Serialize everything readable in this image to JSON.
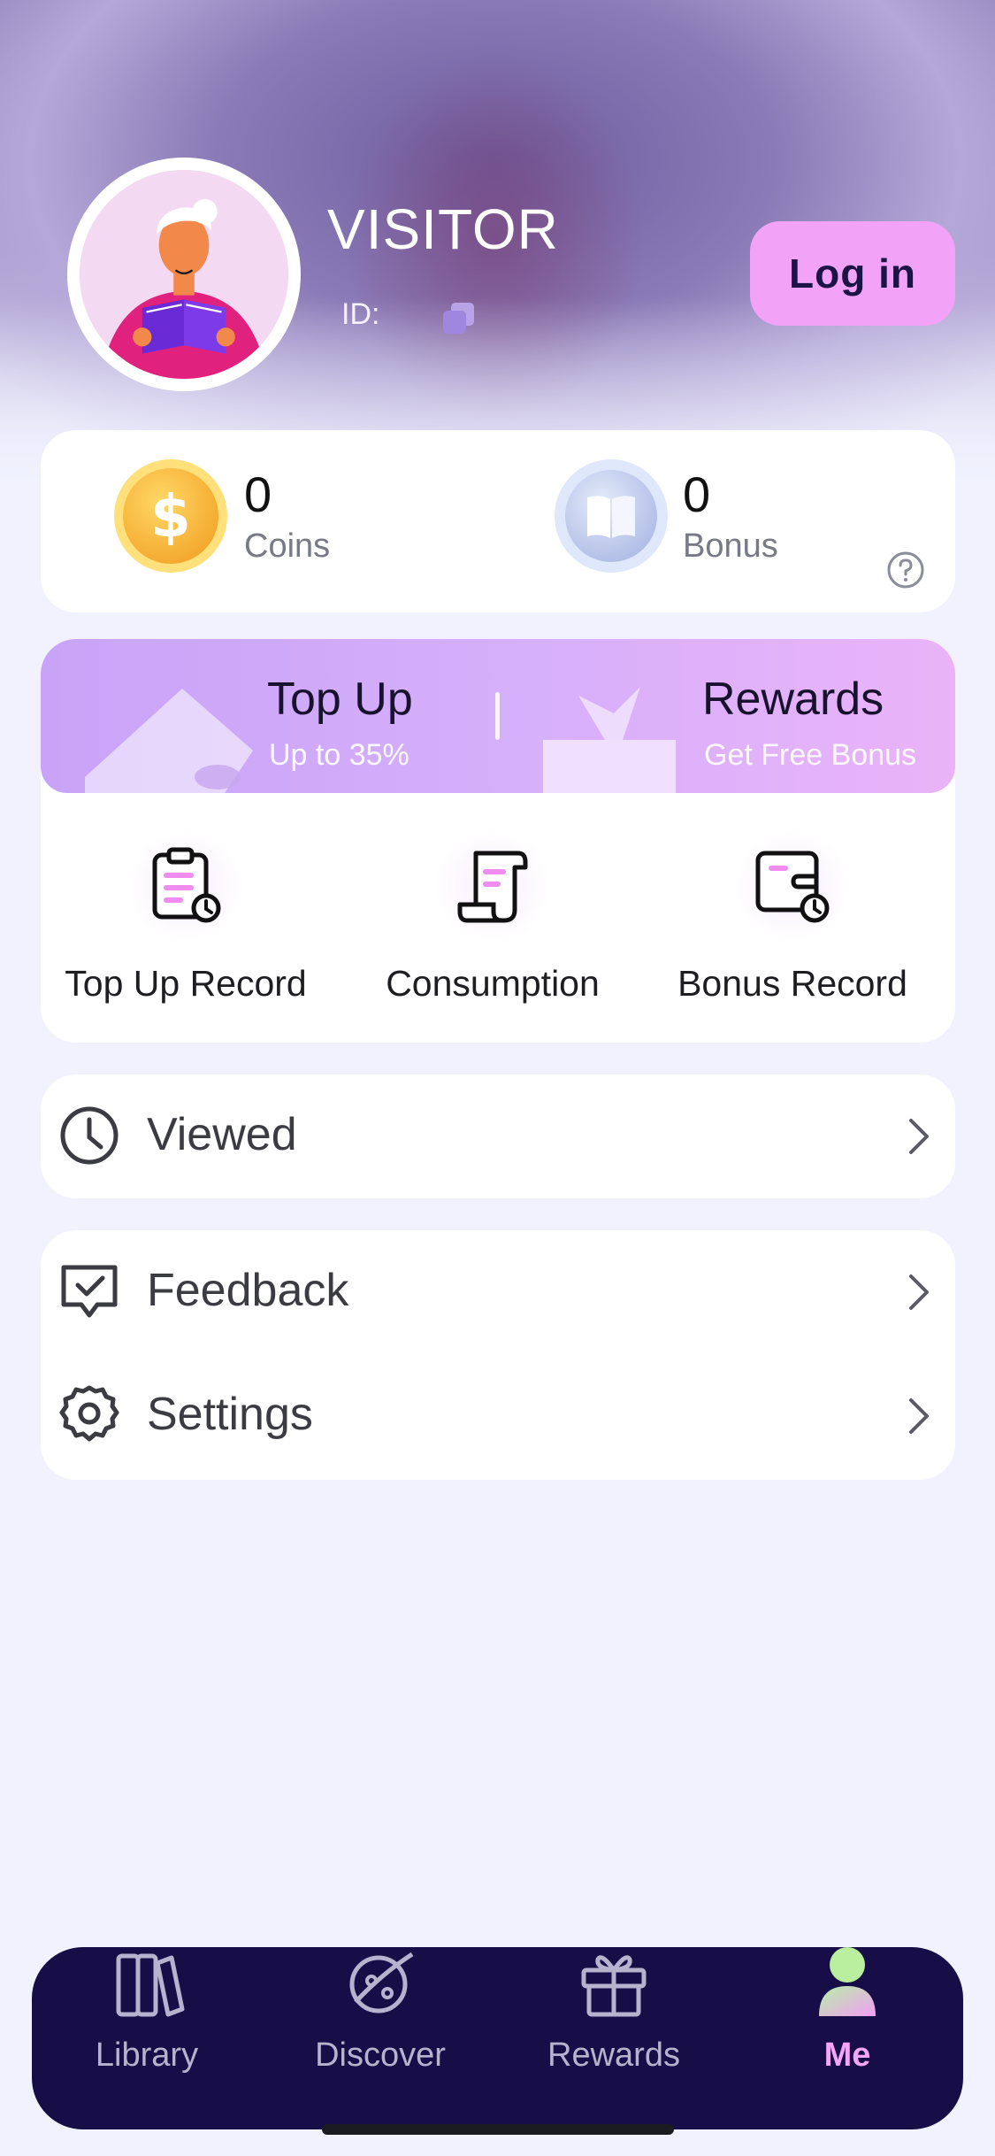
{
  "profile": {
    "name": "VISITOR",
    "id_label": "ID:",
    "login_label": "Log in"
  },
  "balances": {
    "coins_value": "0",
    "coins_label": "Coins",
    "bonus_value": "0",
    "bonus_label": "Bonus"
  },
  "promo": {
    "topup_title": "Top Up",
    "topup_sub": "Up to 35%",
    "rewards_title": "Rewards",
    "rewards_sub": "Get Free Bonus"
  },
  "records": [
    {
      "label": "Top Up Record",
      "icon": "clipboard-clock-icon"
    },
    {
      "label": "Consumption",
      "icon": "scroll-icon"
    },
    {
      "label": "Bonus Record",
      "icon": "card-clock-icon"
    }
  ],
  "menu": {
    "viewed": "Viewed",
    "feedback": "Feedback",
    "settings": "Settings"
  },
  "nav": [
    {
      "label": "Library",
      "icon": "books-icon",
      "active": false
    },
    {
      "label": "Discover",
      "icon": "planet-icon",
      "active": false
    },
    {
      "label": "Rewards",
      "icon": "gift-icon",
      "active": false
    },
    {
      "label": "Me",
      "icon": "person-icon",
      "active": true
    }
  ],
  "colors": {
    "accent_pink": "#f2a3f7",
    "nav_bg": "#170e47",
    "page_bg": "#f1f2fd",
    "promo_start": "#c8a3f7"
  }
}
